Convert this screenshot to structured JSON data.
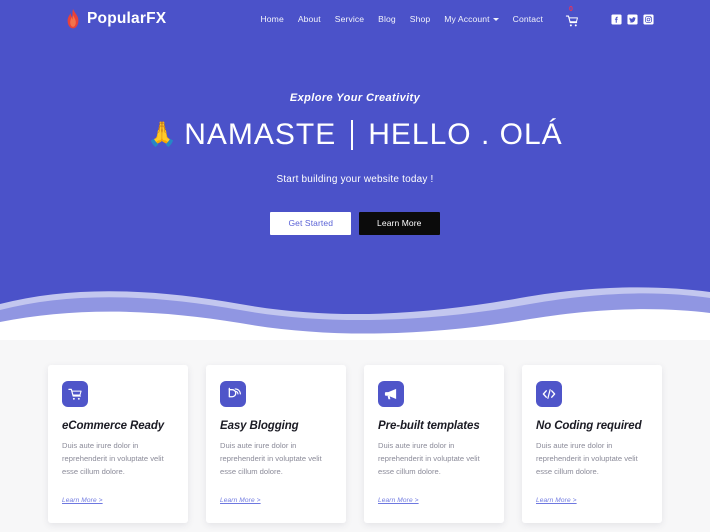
{
  "brand": {
    "name": "PopularFX",
    "logo_icon": "flame-icon",
    "flame_color": "#e8413a"
  },
  "nav": {
    "items": [
      {
        "label": "Home",
        "name": "nav-link-home",
        "dropdown": false
      },
      {
        "label": "About",
        "name": "nav-link-about",
        "dropdown": false
      },
      {
        "label": "Service",
        "name": "nav-link-service",
        "dropdown": false
      },
      {
        "label": "Blog",
        "name": "nav-link-blog",
        "dropdown": false
      },
      {
        "label": "Shop",
        "name": "nav-link-shop",
        "dropdown": false
      },
      {
        "label": "My Account",
        "name": "nav-link-my-account",
        "dropdown": true
      },
      {
        "label": "Contact",
        "name": "nav-link-contact",
        "dropdown": false
      }
    ],
    "cart": {
      "icon": "shopping-cart-icon",
      "badge_count": "0",
      "badge_color": "#e8345a"
    },
    "socials": [
      {
        "icon": "facebook-icon",
        "label": "Facebook"
      },
      {
        "icon": "twitter-icon",
        "label": "Twitter"
      },
      {
        "icon": "instagram-icon",
        "label": "Instagram"
      }
    ]
  },
  "hero": {
    "background_color": "#4b52c9",
    "kicker": "Explore Your Creativity",
    "headline_emoji": "🙏",
    "headline_left": "NAMASTE",
    "headline_right": "HELLO . OLÁ",
    "subline": "Start building your website today !",
    "primary_button": "Get Started",
    "secondary_button": "Learn More"
  },
  "features": {
    "link_label": "Learn More >",
    "cards": [
      {
        "icon": "shopping-cart-icon",
        "title": "eCommerce Ready",
        "body": "Duis aute irure dolor in reprehenderit in voluptate velit esse cillum dolore.",
        "link": "Learn More >"
      },
      {
        "icon": "blogger-icon",
        "title": "Easy Blogging",
        "body": "Duis aute irure dolor in reprehenderit in voluptate velit esse cillum dolore.",
        "link": "Learn More >"
      },
      {
        "icon": "megaphone-icon",
        "title": "Pre-built templates",
        "body": "Duis aute irure dolor in reprehenderit in voluptate velit esse cillum dolore.",
        "link": "Learn More >"
      },
      {
        "icon": "code-icon",
        "title": "No Coding required",
        "body": "Duis aute irure dolor in reprehenderit in voluptate velit esse cillum dolore.",
        "link": "Learn More >"
      }
    ]
  },
  "colors": {
    "hero": "#4b52c9",
    "wave_light": "#8d93e0",
    "wave_pale": "#c3c7ef",
    "page_bg": "#f7f7f8",
    "icon_tile": "#4f55c9",
    "link": "#6e78e0",
    "dark_button": "#0b0b0b"
  }
}
